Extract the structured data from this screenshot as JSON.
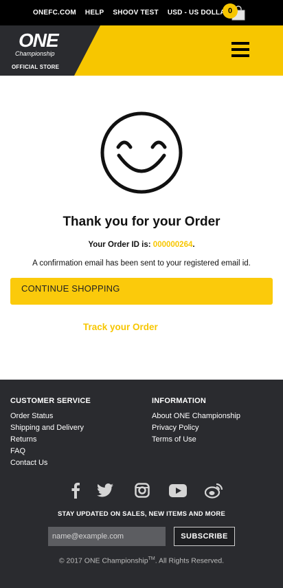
{
  "topbar": {
    "links": [
      "ONEFC.COM",
      "HELP",
      "SHOOV TEST",
      "USD - US DOLLAR"
    ],
    "cart_count": "0"
  },
  "header": {
    "logo_text": "ONE",
    "logo_sub": "Championship",
    "store_label": "OFFICIAL STORE",
    "accent_color": "#f7c600"
  },
  "main": {
    "title": "Thank you for your Order",
    "order_prefix": "Your Order ID is: ",
    "order_id": "000000264",
    "order_suffix": ".",
    "confirmation": "A confirmation email has been sent to your registered email id.",
    "continue_label": "CONTINUE SHOPPING",
    "track_label": "Track your Order"
  },
  "footer": {
    "customer_service": {
      "heading": "CUSTOMER SERVICE",
      "links": [
        "Order Status",
        "Shipping and Delivery",
        "Returns",
        "FAQ",
        "Contact Us"
      ]
    },
    "information": {
      "heading": "INFORMATION",
      "links": [
        "About ONE Championship",
        "Privacy Policy",
        "Terms of Use"
      ]
    },
    "social": [
      "facebook-icon",
      "twitter-icon",
      "instagram-icon",
      "youtube-icon",
      "weibo-icon"
    ],
    "newsletter": {
      "heading": "STAY UPDATED ON SALES, NEW ITEMS AND MORE",
      "placeholder": "name@example.com",
      "button": "SUBSCRIBE"
    },
    "copyright_prefix": "© 2017 ONE Championship",
    "copyright_tm": "TM",
    "copyright_suffix": ". All Rights Reserved."
  }
}
